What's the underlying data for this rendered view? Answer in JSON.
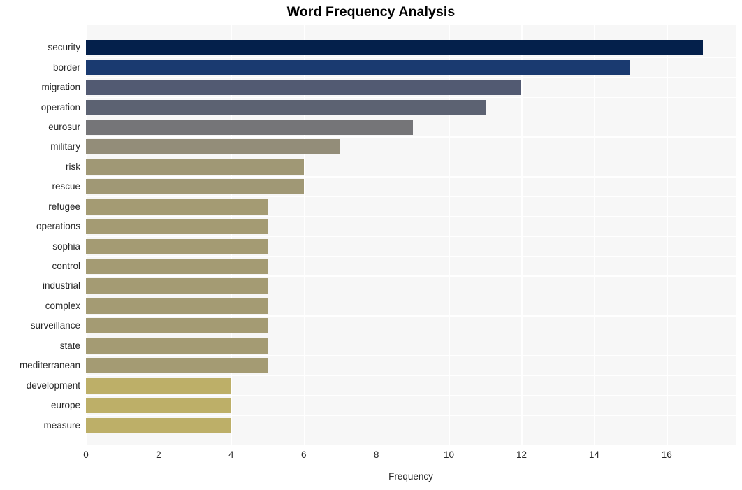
{
  "chart_data": {
    "type": "bar",
    "orientation": "horizontal",
    "title": "Word Frequency Analysis",
    "xlabel": "Frequency",
    "ylabel": "",
    "xlim": [
      0,
      17.9
    ],
    "xticks": [
      0,
      2,
      4,
      6,
      8,
      10,
      12,
      14,
      16
    ],
    "grid": true,
    "legend": "none",
    "categories": [
      "security",
      "border",
      "migration",
      "operation",
      "eurosur",
      "military",
      "risk",
      "rescue",
      "refugee",
      "operations",
      "sophia",
      "control",
      "industrial",
      "complex",
      "surveillance",
      "state",
      "mediterranean",
      "development",
      "europe",
      "measure"
    ],
    "values": [
      17,
      15,
      12,
      11,
      9,
      7,
      6,
      6,
      5,
      5,
      5,
      5,
      5,
      5,
      5,
      5,
      5,
      4,
      4,
      4
    ],
    "bar_colors": [
      "#04204b",
      "#1a3a70",
      "#525a72",
      "#5c6272",
      "#757578",
      "#938d79",
      "#a09875",
      "#a09875",
      "#a49b73",
      "#a49b73",
      "#a49b73",
      "#a49b73",
      "#a49b73",
      "#a49b73",
      "#a49b73",
      "#a49b73",
      "#a49b73",
      "#bdaf68",
      "#bdaf68",
      "#bdaf68"
    ]
  },
  "style": {
    "plot_background": "#f7f7f7",
    "page_background": "#ffffff",
    "gridline_color": "#ffffff",
    "text_color": "#262626",
    "title_color": "#000000"
  }
}
